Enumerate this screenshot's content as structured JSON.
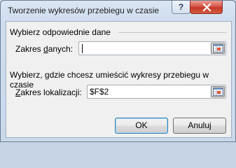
{
  "window": {
    "title": "Tworzenie wykresów przebiegu w czasie",
    "help_label": "?",
    "close_icon": "close-icon"
  },
  "data_group": {
    "heading": "Wybierz odpowiednie dane",
    "range_label_pre": "Zakres ",
    "range_label_accel": "d",
    "range_label_post": "anych:",
    "range_value": "",
    "range_button_icon": "range-select-icon"
  },
  "location_group": {
    "heading": "Wybierz, gdzie chcesz umieścić wykresy przebiegu w czasie",
    "location_label_pre": "",
    "location_label_accel": "Z",
    "location_label_post": "akres lokalizacji:",
    "location_value": "$F$2",
    "range_button_icon": "range-select-icon"
  },
  "buttons": {
    "ok": "OK",
    "cancel": "Anuluj"
  }
}
